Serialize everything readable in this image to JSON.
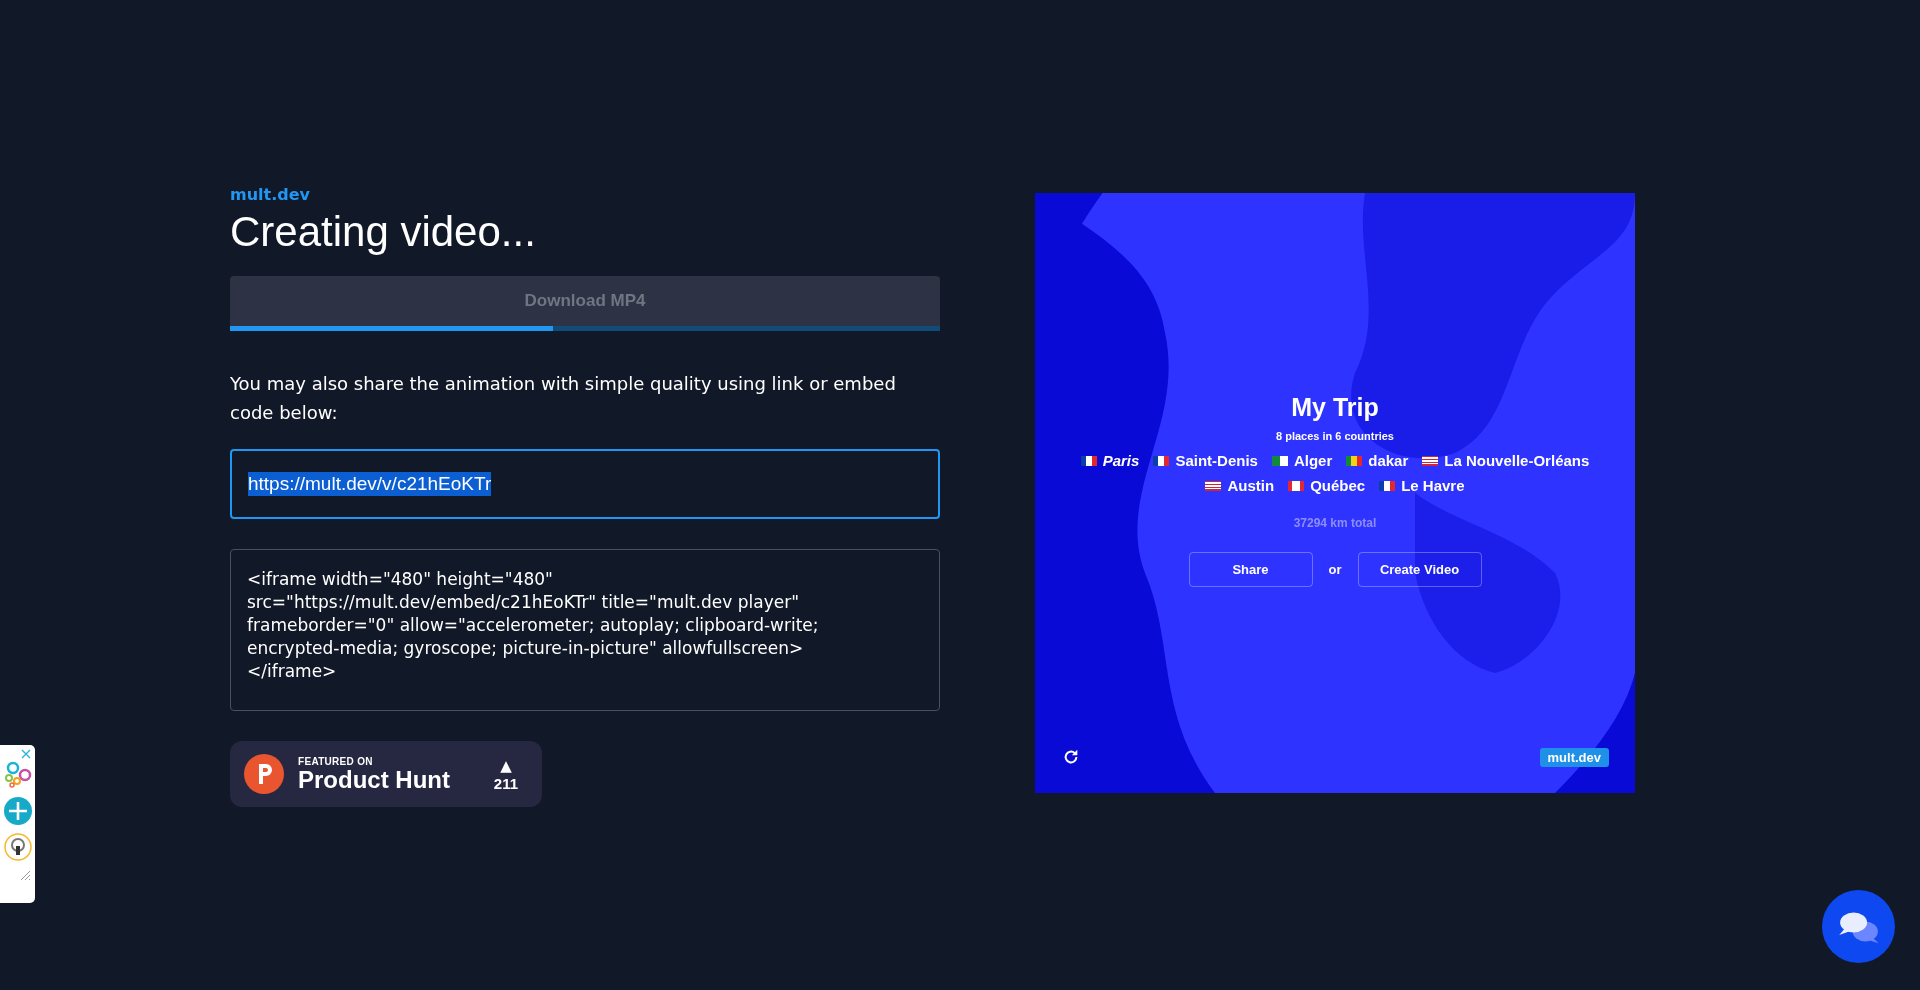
{
  "brand": "mult.dev",
  "heading": "Creating video...",
  "download": {
    "label": "Download MP4",
    "disabled": true,
    "level": 0.455
  },
  "share_text": "You may also share the animation with simple quality using link or embed code below:",
  "link_field": {
    "value": "https://mult.dev/v/c21hEoKTr",
    "selected": true
  },
  "embed_code": "<iframe width=\"480\" height=\"480\" src=\"https://mult.dev/embed/c21hEoKTr\" title=\"mult.dev player\" frameborder=\"0\" allow=\"accelerometer; autoplay; clipboard-write; encrypted-media; gyroscope; picture-in-picture\" allowfullscreen></iframe>",
  "product_hunt": {
    "featured": "FEATURED ON",
    "name": "Product Hunt",
    "upvote": "▲",
    "count": "211"
  },
  "player": {
    "title": "My Trip",
    "subtitle": "8 places in 6 countries",
    "places": [
      {
        "name": "Paris",
        "kind": "fr",
        "italic": true
      },
      {
        "name": "Saint-Denis",
        "kind": "fr",
        "italic": false
      },
      {
        "name": "Alger",
        "kind": "dz",
        "italic": false
      },
      {
        "name": "dakar",
        "kind": "sn",
        "italic": false
      },
      {
        "name": "La Nouvelle-Orléans",
        "kind": "us",
        "italic": false
      },
      {
        "name": "Austin",
        "kind": "us",
        "italic": false
      },
      {
        "name": "Québec",
        "kind": "ca",
        "italic": false
      },
      {
        "name": "Le Havre",
        "kind": "fr",
        "italic": false
      }
    ],
    "total": "37294 km total",
    "share_button": "Share",
    "or": "or",
    "create_button": "Create Video",
    "badge": "mult.dev"
  }
}
